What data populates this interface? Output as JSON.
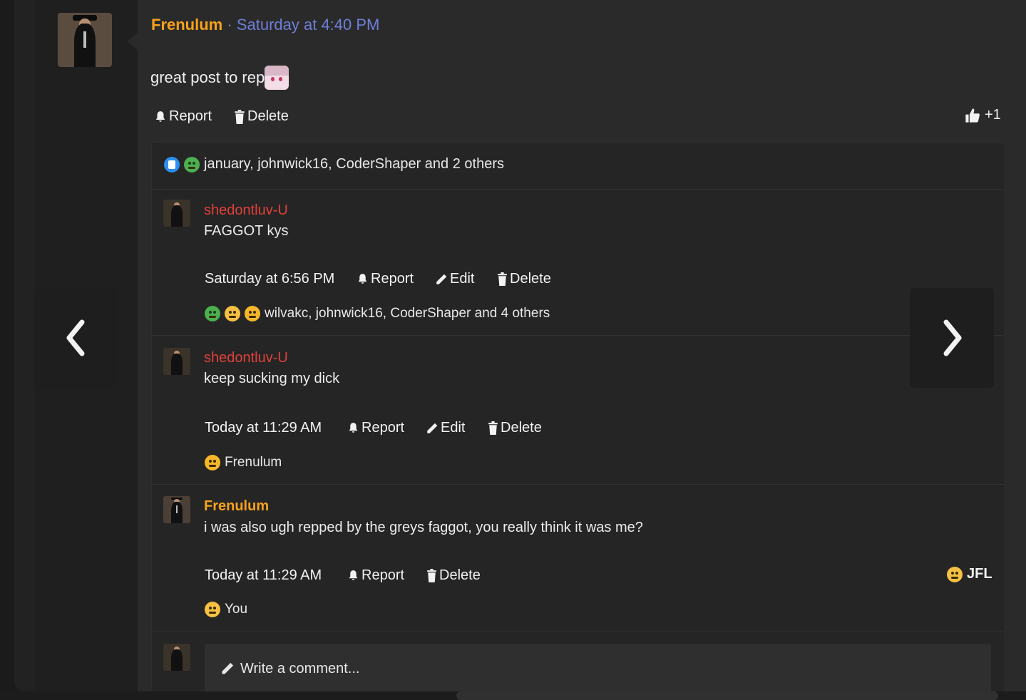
{
  "post": {
    "author": "Frenulum",
    "separator": "·",
    "timestamp": "Saturday at 4:40 PM",
    "text": "great post to rep",
    "actions": {
      "report": "Report",
      "delete": "Delete"
    },
    "vote_count": "+1"
  },
  "reactions_summary": {
    "icons": [
      "like-icon",
      "sick-face-icon"
    ],
    "text": "january, johnwick16, CoderShaper and 2 others"
  },
  "comments": [
    {
      "author": "shedontluv-U",
      "author_color": "#e0403a",
      "text": "FAGGOT kys",
      "timestamp": "Saturday at 6:56 PM",
      "actions": {
        "report": "Report",
        "edit": "Edit",
        "delete": "Delete"
      },
      "reactions": {
        "icons": [
          "sick-face-icon",
          "laughing-face-icon",
          "confused-face-icon"
        ],
        "text": "wilvakc, johnwick16, CoderShaper and 4 others"
      }
    },
    {
      "author": "shedontluv-U",
      "author_color": "#e0403a",
      "text": "keep sucking my dick",
      "timestamp": "Today at 11:29 AM",
      "actions": {
        "report": "Report",
        "edit": "Edit",
        "delete": "Delete"
      },
      "reactions": {
        "icons": [
          "confused-face-icon"
        ],
        "text": "Frenulum"
      }
    },
    {
      "author": "Frenulum",
      "author_color": "#f7a21b",
      "text": "i was also ugh repped by the greys faggot, you really think it was me?",
      "timestamp": "Today at 11:29 AM",
      "actions": {
        "report": "Report",
        "delete": "Delete"
      },
      "reaction_button": "JFL",
      "reactions": {
        "icons": [
          "laughing-face-icon"
        ],
        "text": "You"
      }
    }
  ],
  "comment_input": {
    "placeholder": "Write a comment..."
  },
  "navigation": {
    "prev": "chevron-left-icon",
    "next": "chevron-right-icon"
  },
  "colors": {
    "author_orange": "#f7a21b",
    "timestamp_blue": "#6f7fd8",
    "author_red": "#e0403a"
  }
}
